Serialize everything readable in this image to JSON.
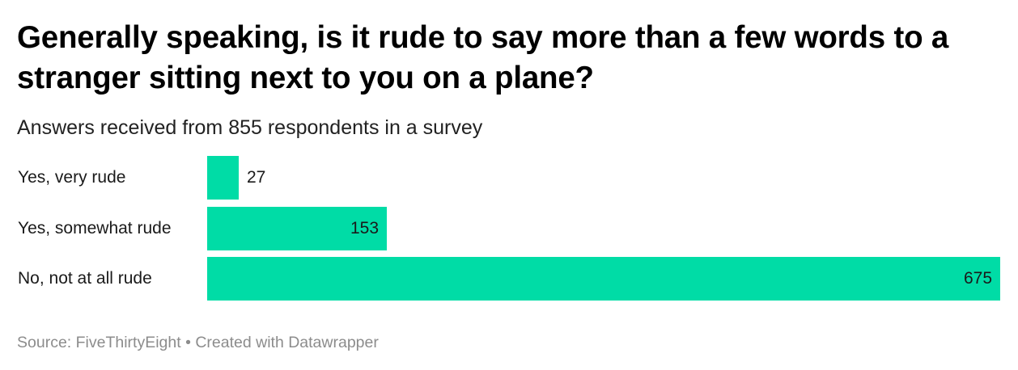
{
  "header": {
    "title": "Generally speaking, is it rude to say more than a few words to a stranger sitting next to you on a plane?",
    "subtitle": "Answers received from 855 respondents in a survey"
  },
  "footer": {
    "source_label": "Source: FiveThirtyEight",
    "separator": "•",
    "credit": "Created with Datawrapper"
  },
  "colors": {
    "bar": "#00dca6"
  },
  "chart_data": {
    "type": "bar",
    "orientation": "horizontal",
    "categories": [
      "Yes, very rude",
      "Yes, somewhat rude",
      "No, not at all rude"
    ],
    "values": [
      27,
      153,
      675
    ],
    "xlim": [
      0,
      675
    ],
    "grid": false,
    "legend": "none"
  }
}
